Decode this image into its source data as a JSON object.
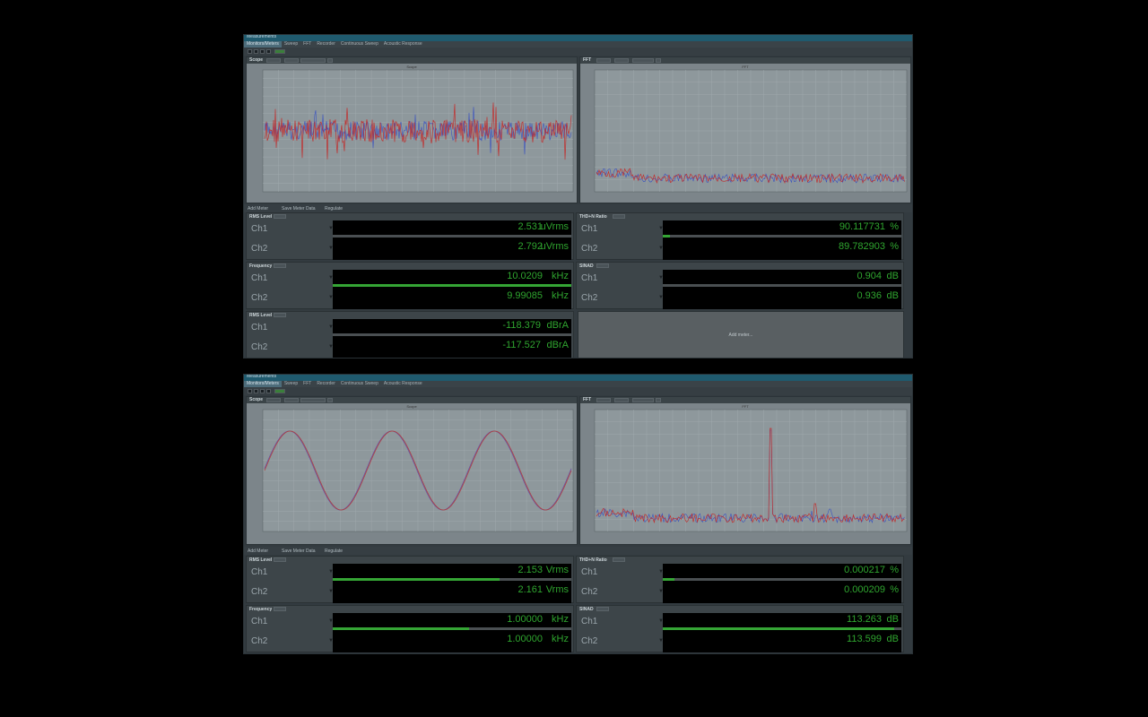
{
  "window": {
    "title": "Measurements"
  },
  "menu": [
    "Monitors/Meters",
    "Sweep",
    "FFT",
    "Recorder",
    "Continuous Sweep",
    "Acoustic Response"
  ],
  "toolbar": {
    "on_label": "ON"
  },
  "panels": {
    "scope_title": "Scope",
    "fft_title": "FFT",
    "scope_plot_title": "Scope",
    "fft_plot_title": "FFT"
  },
  "meter_toolbar": {
    "add_meter": "Add Meter",
    "save_meter_data": "Save Meter Data",
    "regulate": "Regulate"
  },
  "add_meter_placeholder": "Add meter...",
  "colors": {
    "reading": "#2fa52f",
    "ch1_trace": "#c0302f",
    "ch2_trace": "#3a52c0"
  },
  "screens": [
    {
      "meters": {
        "rms": {
          "title": "RMS Level",
          "ch1": {
            "label": "Ch1",
            "value": "2.531",
            "unit": "uVrms",
            "level": 0.0
          },
          "ch2": {
            "label": "Ch2",
            "value": "2.792",
            "unit": "uVrms",
            "level": 0.0
          }
        },
        "thdn": {
          "title": "THD+N Ratio",
          "ch1": {
            "label": "Ch1",
            "value": "90.117731",
            "unit": "%",
            "level": 0.03
          },
          "ch2": {
            "label": "Ch2",
            "value": "89.782903",
            "unit": "%",
            "level": 0.03
          }
        },
        "freq": {
          "title": "Frequency",
          "ch1": {
            "label": "Ch1",
            "value": "10.0209",
            "unit": "kHz",
            "level": 1.0
          },
          "ch2": {
            "label": "Ch2",
            "value": "9.99085",
            "unit": "kHz",
            "level": 1.0
          }
        },
        "sinad": {
          "title": "SINAD",
          "ch1": {
            "label": "Ch1",
            "value": "0.904",
            "unit": "dB",
            "level": 0.0
          },
          "ch2": {
            "label": "Ch2",
            "value": "0.936",
            "unit": "dB",
            "level": 0.0
          }
        },
        "rms2": {
          "title": "RMS Level",
          "ch1": {
            "label": "Ch1",
            "value": "-118.379",
            "unit": "dBrA",
            "level": 0.0
          },
          "ch2": {
            "label": "Ch2",
            "value": "-117.527",
            "unit": "dBrA",
            "level": 0.0
          }
        }
      }
    },
    {
      "meters": {
        "rms": {
          "title": "RMS Level",
          "ch1": {
            "label": "Ch1",
            "value": "2.153",
            "unit": "Vrms",
            "level": 0.7
          },
          "ch2": {
            "label": "Ch2",
            "value": "2.161",
            "unit": "Vrms",
            "level": 0.7
          }
        },
        "thdn": {
          "title": "THD+N Ratio",
          "ch1": {
            "label": "Ch1",
            "value": "0.000217",
            "unit": "%",
            "level": 0.05
          },
          "ch2": {
            "label": "Ch2",
            "value": "0.000209",
            "unit": "%",
            "level": 0.05
          }
        },
        "freq": {
          "title": "Frequency",
          "ch1": {
            "label": "Ch1",
            "value": "1.00000",
            "unit": "kHz",
            "level": 0.57
          },
          "ch2": {
            "label": "Ch2",
            "value": "1.00000",
            "unit": "kHz",
            "level": 0.57
          }
        },
        "sinad": {
          "title": "SINAD",
          "ch1": {
            "label": "Ch1",
            "value": "113.263",
            "unit": "dB",
            "level": 0.97
          },
          "ch2": {
            "label": "Ch2",
            "value": "113.599",
            "unit": "dB",
            "level": 0.97
          }
        }
      }
    }
  ]
}
